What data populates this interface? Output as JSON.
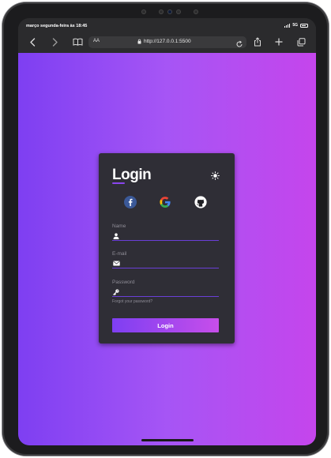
{
  "status_bar": {
    "time": "março segunda-feira às 18:45",
    "network": "5G"
  },
  "browser": {
    "text_size_label": "AA",
    "url": "http://127.0.0.1:5500"
  },
  "login": {
    "title": "Login",
    "social": [
      "facebook-icon",
      "google-icon",
      "github-icon"
    ],
    "fields": {
      "name_label": "Name",
      "email_label": "E-mail",
      "password_label": "Password"
    },
    "forgot_link": "Forgot your password?",
    "submit_label": "Login"
  },
  "colors": {
    "gradient_start": "#7e3ff2",
    "gradient_mid": "#a655f5",
    "gradient_end": "#c545ec",
    "card_bg": "#2f2e36",
    "accent": "#8a45ee"
  }
}
